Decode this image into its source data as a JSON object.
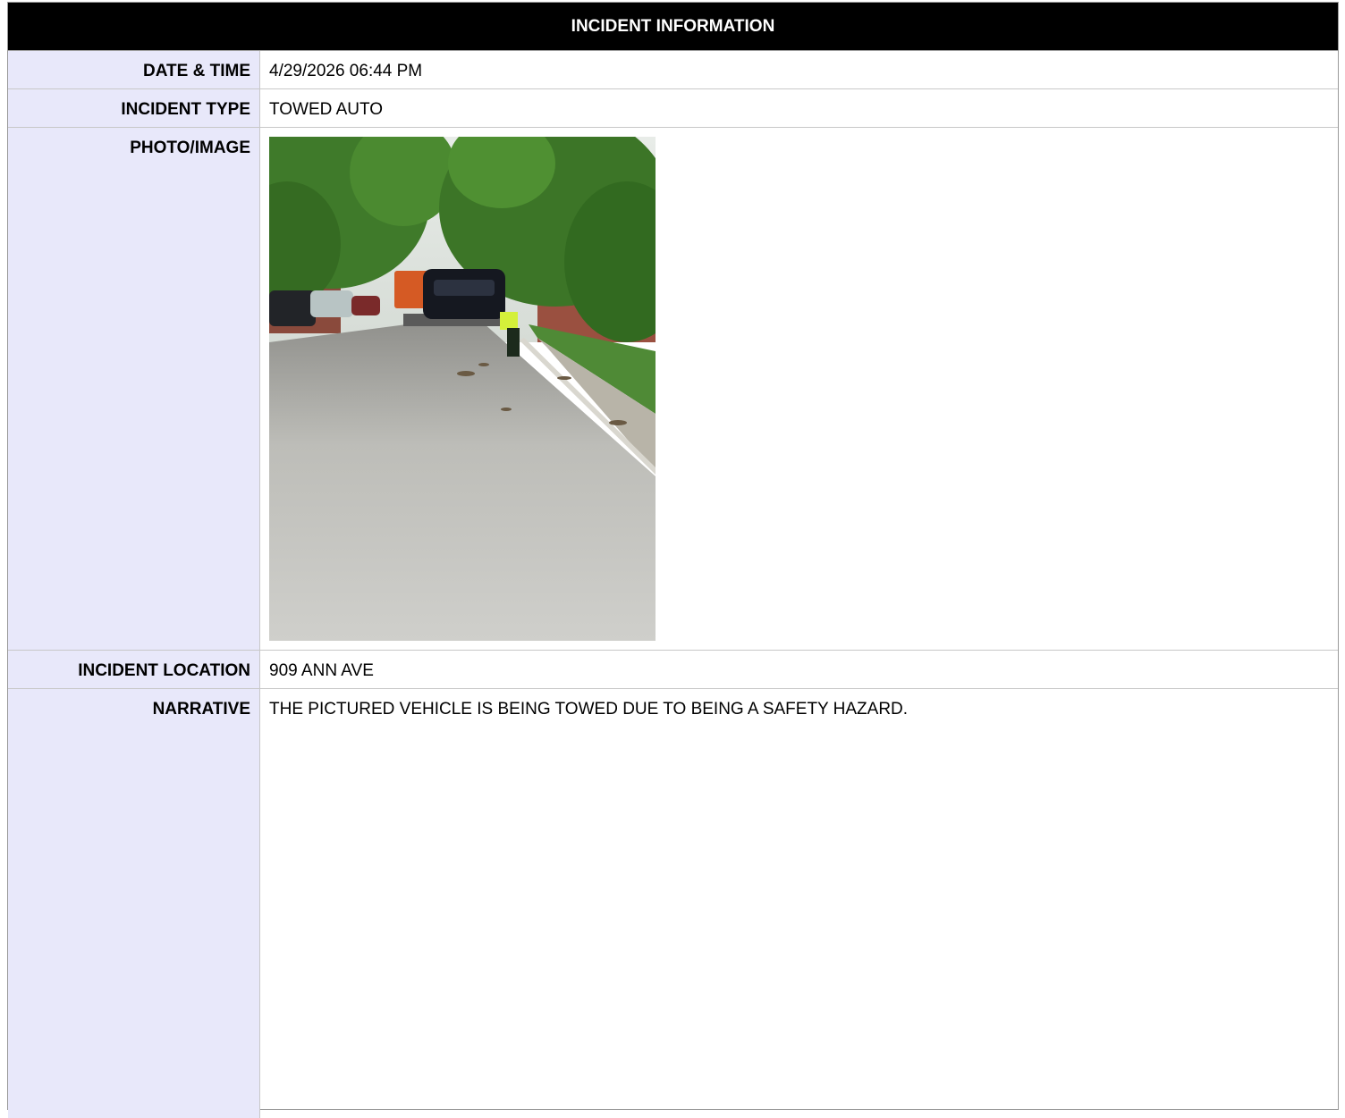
{
  "header": {
    "title": "INCIDENT INFORMATION"
  },
  "fields": {
    "date_time": {
      "label": "DATE & TIME",
      "value": "4/29/2026 06:44 PM"
    },
    "incident_type": {
      "label": "INCIDENT TYPE",
      "value": "TOWED AUTO"
    },
    "photo": {
      "label": "PHOTO/IMAGE"
    },
    "location": {
      "label": "INCIDENT LOCATION",
      "value": "909 ANN AVE"
    },
    "narrative": {
      "label": "NARRATIVE",
      "value": "THE PICTURED VEHICLE IS BEING TOWED DUE TO BEING A SAFETY HAZARD."
    }
  },
  "colors": {
    "header_bg": "#000000",
    "label_bg": "#e8e8fa",
    "border": "#c8c8c8"
  }
}
